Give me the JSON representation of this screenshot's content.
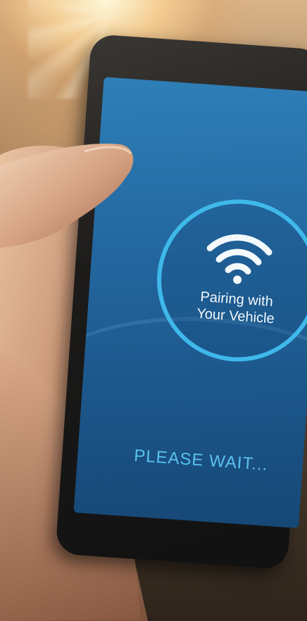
{
  "screen": {
    "pairing_line1": "Pairing with",
    "pairing_line2": "Your Vehicle",
    "wait_message": "PLEASE WAIT..."
  },
  "icons": {
    "status": "wifi-icon"
  },
  "colors": {
    "screen_blue": "#2469a2",
    "ring_accent": "#3fb8ea",
    "wait_text": "#59c2ee"
  }
}
